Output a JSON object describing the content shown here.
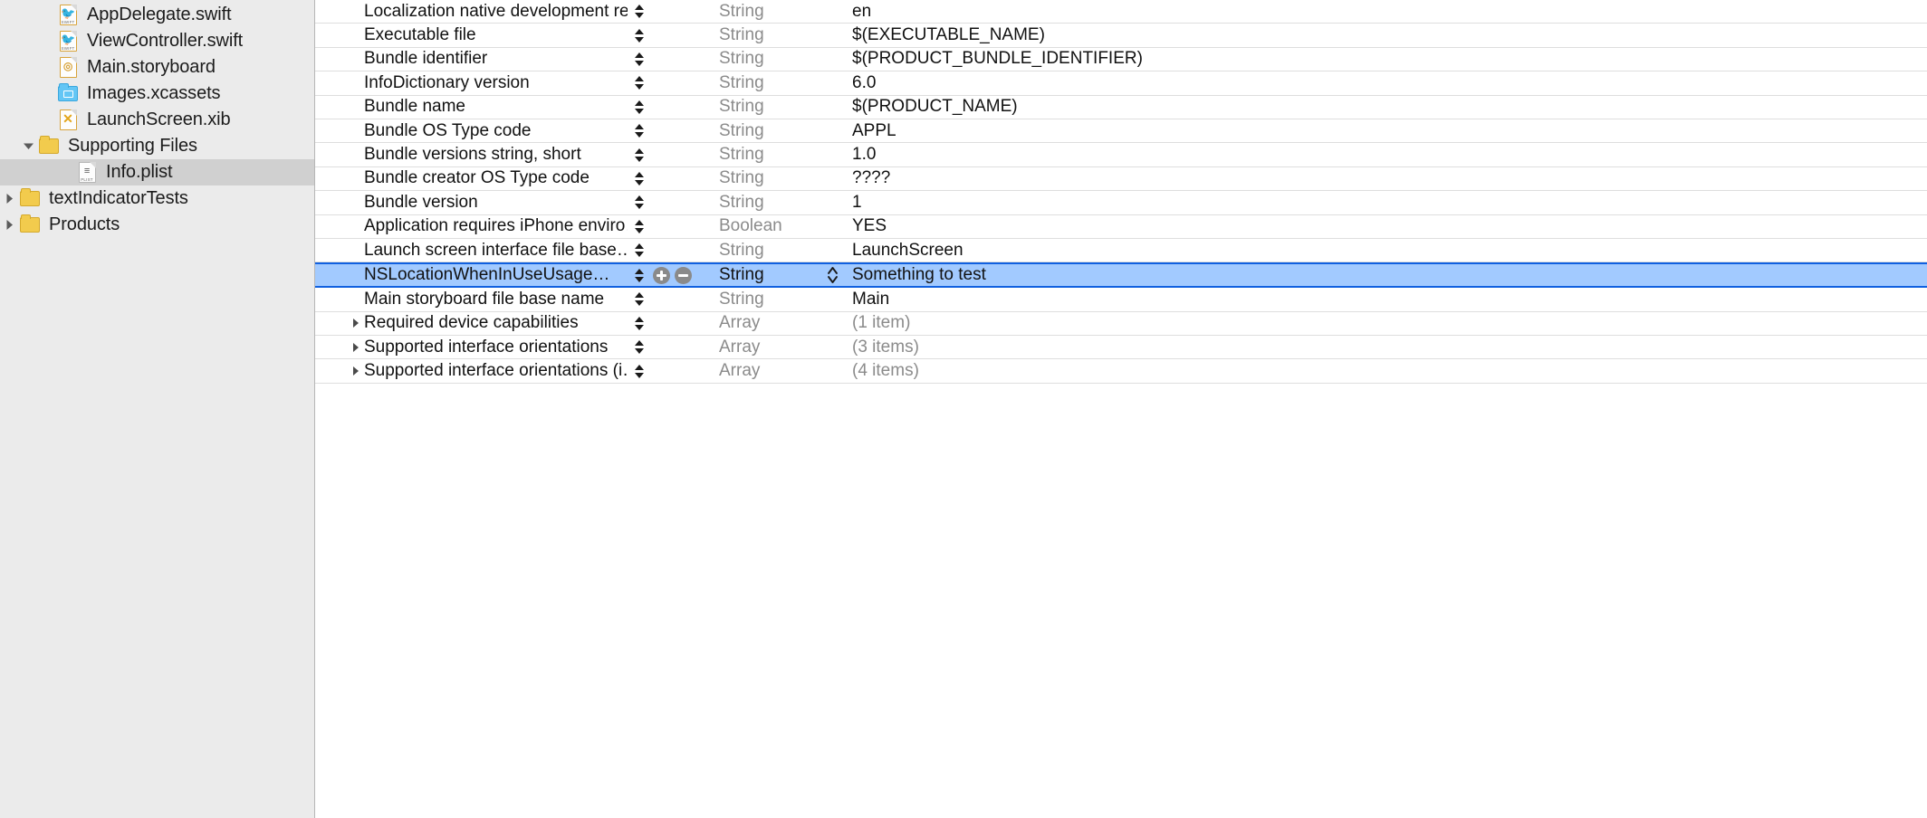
{
  "sidebar": {
    "items": [
      {
        "label": "AppDelegate.swift",
        "icon": "swift-file-icon",
        "kind": "swift",
        "indent": 2,
        "twisty": "none",
        "selected": false
      },
      {
        "label": "ViewController.swift",
        "icon": "swift-file-icon",
        "kind": "swift",
        "indent": 2,
        "twisty": "none",
        "selected": false
      },
      {
        "label": "Main.storyboard",
        "icon": "storyboard-file-icon",
        "kind": "storyboard",
        "indent": 2,
        "twisty": "none",
        "selected": false
      },
      {
        "label": "Images.xcassets",
        "icon": "assets-folder-icon",
        "kind": "assets",
        "indent": 2,
        "twisty": "none",
        "selected": false
      },
      {
        "label": "LaunchScreen.xib",
        "icon": "xib-file-icon",
        "kind": "xib",
        "indent": 2,
        "twisty": "none",
        "selected": false
      },
      {
        "label": "Supporting Files",
        "icon": "folder-icon",
        "kind": "folder",
        "indent": 1,
        "twisty": "expanded",
        "selected": false
      },
      {
        "label": "Info.plist",
        "icon": "plist-file-icon",
        "kind": "plist",
        "indent": 3,
        "twisty": "none",
        "selected": true
      },
      {
        "label": "textIndicatorTests",
        "icon": "folder-icon",
        "kind": "folder",
        "indent": 0,
        "twisty": "collapsed",
        "selected": false
      },
      {
        "label": "Products",
        "icon": "folder-icon",
        "kind": "folder",
        "indent": 0,
        "twisty": "collapsed",
        "selected": false
      }
    ]
  },
  "plist": {
    "rows": [
      {
        "key": "Localization native development re…",
        "type": "String",
        "value": "en",
        "disclosure": "none",
        "selected": false
      },
      {
        "key": "Executable file",
        "type": "String",
        "value": "$(EXECUTABLE_NAME)",
        "disclosure": "none",
        "selected": false
      },
      {
        "key": "Bundle identifier",
        "type": "String",
        "value": "$(PRODUCT_BUNDLE_IDENTIFIER)",
        "disclosure": "none",
        "selected": false
      },
      {
        "key": "InfoDictionary version",
        "type": "String",
        "value": "6.0",
        "disclosure": "none",
        "selected": false
      },
      {
        "key": "Bundle name",
        "type": "String",
        "value": "$(PRODUCT_NAME)",
        "disclosure": "none",
        "selected": false
      },
      {
        "key": "Bundle OS Type code",
        "type": "String",
        "value": "APPL",
        "disclosure": "none",
        "selected": false
      },
      {
        "key": "Bundle versions string, short",
        "type": "String",
        "value": "1.0",
        "disclosure": "none",
        "selected": false
      },
      {
        "key": "Bundle creator OS Type code",
        "type": "String",
        "value": "????",
        "disclosure": "none",
        "selected": false
      },
      {
        "key": "Bundle version",
        "type": "String",
        "value": "1",
        "disclosure": "none",
        "selected": false
      },
      {
        "key": "Application requires iPhone enviro…",
        "type": "Boolean",
        "value": "YES",
        "disclosure": "none",
        "selected": false
      },
      {
        "key": "Launch screen interface file base…",
        "type": "String",
        "value": "LaunchScreen",
        "disclosure": "none",
        "selected": false
      },
      {
        "key": "NSLocationWhenInUseUsage…",
        "type": "String",
        "value": "Something to test",
        "disclosure": "none",
        "selected": true
      },
      {
        "key": "Main storyboard file base name",
        "type": "String",
        "value": "Main",
        "disclosure": "none",
        "selected": false
      },
      {
        "key": "Required device capabilities",
        "type": "Array",
        "value": "(1 item)",
        "disclosure": "collapsed",
        "selected": false
      },
      {
        "key": "Supported interface orientations",
        "type": "Array",
        "value": "(3 items)",
        "disclosure": "collapsed",
        "selected": false
      },
      {
        "key": "Supported interface orientations (i…",
        "type": "Array",
        "value": "(4 items)",
        "disclosure": "collapsed",
        "selected": false
      }
    ]
  },
  "colors": {
    "selection_blue": "#a2caff",
    "selection_border": "#1060e0",
    "sidebar_bg": "#ebebeb",
    "sidebar_selected": "#d0d0d0",
    "muted_text": "#8b8b8b",
    "row_divider": "#dedede"
  }
}
